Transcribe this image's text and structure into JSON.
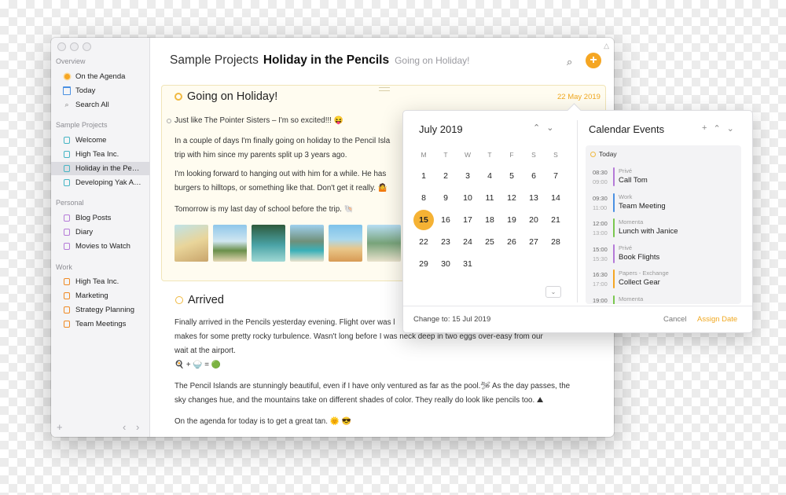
{
  "sidebar": {
    "sections": {
      "overview": "Overview",
      "sample": "Sample Projects",
      "personal": "Personal",
      "work": "Work"
    },
    "overview_items": [
      {
        "label": "On the Agenda"
      },
      {
        "label": "Today"
      },
      {
        "label": "Search All"
      }
    ],
    "sample_items": [
      {
        "label": "Welcome"
      },
      {
        "label": "High Tea Inc."
      },
      {
        "label": "Holiday in the Pencils"
      },
      {
        "label": "Developing Yak Apps"
      }
    ],
    "personal_items": [
      {
        "label": "Blog Posts"
      },
      {
        "label": "Diary"
      },
      {
        "label": "Movies to Watch"
      }
    ],
    "work_items": [
      {
        "label": "High Tea Inc."
      },
      {
        "label": "Marketing"
      },
      {
        "label": "Strategy Planning"
      },
      {
        "label": "Team Meetings"
      }
    ],
    "footer": {
      "add": "+",
      "back": "‹",
      "forward": "›"
    }
  },
  "header": {
    "project": "Sample Projects",
    "title": "Holiday in the Pencils",
    "subtitle": "Going on Holiday!",
    "search_icon": "⌕",
    "add_icon": "+"
  },
  "entry1": {
    "title": "Going on Holiday!",
    "date": "22 May 2019",
    "p1": "Just like The Pointer Sisters – I'm so excited!!! 😝",
    "p2a": "In a couple of days I'm finally going on holiday to the Pencil Isla",
    "p2b": "trip with him since my parents split up 3 years ago.",
    "p3a": "I'm looking forward to hanging out with him for a while. He has",
    "p3b": "burgers to hilltops, or something like that. Don't get it really. 🤷",
    "p4": "Tomorrow is my last day of school before the trip. 🐚"
  },
  "entry2": {
    "title": "Arrived",
    "p1a": "Finally arrived in the Pencils yesterday evening. Flight over was l",
    "p1b": "makes for some pretty rocky turbulence. Wasn't long before I was neck deep in two eggs over-easy from our",
    "p1c": "wait at the airport.",
    "p1d": "🍳 + 🍚 = 🟢",
    "p2a": "The Pencil Islands are stunningly beautiful, even if I have only ventured as far as the pool.🛩 As the day passes, the",
    "p2b": "sky changes hue, and the mountains take on different shades of color. They really do look like pencils too. ⛰",
    "p3": "On the agenda for today is to get a great tan. 🌞 😎"
  },
  "calendar": {
    "month": "July 2019",
    "nav_up": "⌃",
    "nav_down": "⌄",
    "weekdays": [
      "M",
      "T",
      "W",
      "T",
      "F",
      "S",
      "S"
    ],
    "weeks": [
      [
        "1",
        "2",
        "3",
        "4",
        "5",
        "6",
        "7"
      ],
      [
        "8",
        "9",
        "10",
        "11",
        "12",
        "13",
        "14"
      ],
      [
        "15",
        "16",
        "17",
        "18",
        "19",
        "20",
        "21"
      ],
      [
        "22",
        "23",
        "24",
        "25",
        "26",
        "27",
        "28"
      ],
      [
        "29",
        "30",
        "31",
        "",
        "",
        "",
        ""
      ]
    ],
    "selected": "15",
    "more": "⌄"
  },
  "events": {
    "title": "Calendar Events",
    "add": "+",
    "up": "⌃",
    "down": "⌄",
    "today": "Today",
    "items": [
      {
        "start": "08:30",
        "end": "09:00",
        "calendar": "Privé",
        "name": "Call Tom",
        "color": "#b57ad8"
      },
      {
        "start": "09:30",
        "end": "11:00",
        "calendar": "Work",
        "name": "Team Meeting",
        "color": "#4a90e2"
      },
      {
        "start": "12:00",
        "end": "13:00",
        "calendar": "Momenta",
        "name": "Lunch with Janice",
        "color": "#7ac74f"
      },
      {
        "start": "15:00",
        "end": "15:30",
        "calendar": "Privé",
        "name": "Book Flights",
        "color": "#b57ad8"
      },
      {
        "start": "16:30",
        "end": "17:00",
        "calendar": "Papers - Exchange",
        "name": "Collect Gear",
        "color": "#f5a623"
      },
      {
        "start": "19:00",
        "end": "",
        "calendar": "Momenta",
        "name": "",
        "color": "#7ac74f"
      }
    ]
  },
  "footer": {
    "change": "Change to: 15 Jul 2019",
    "cancel": "Cancel",
    "assign": "Assign Date"
  },
  "colors": {
    "accent": "#f5a623",
    "sidebar": "#f4f4f6",
    "selected_row": "#dcdce1"
  }
}
